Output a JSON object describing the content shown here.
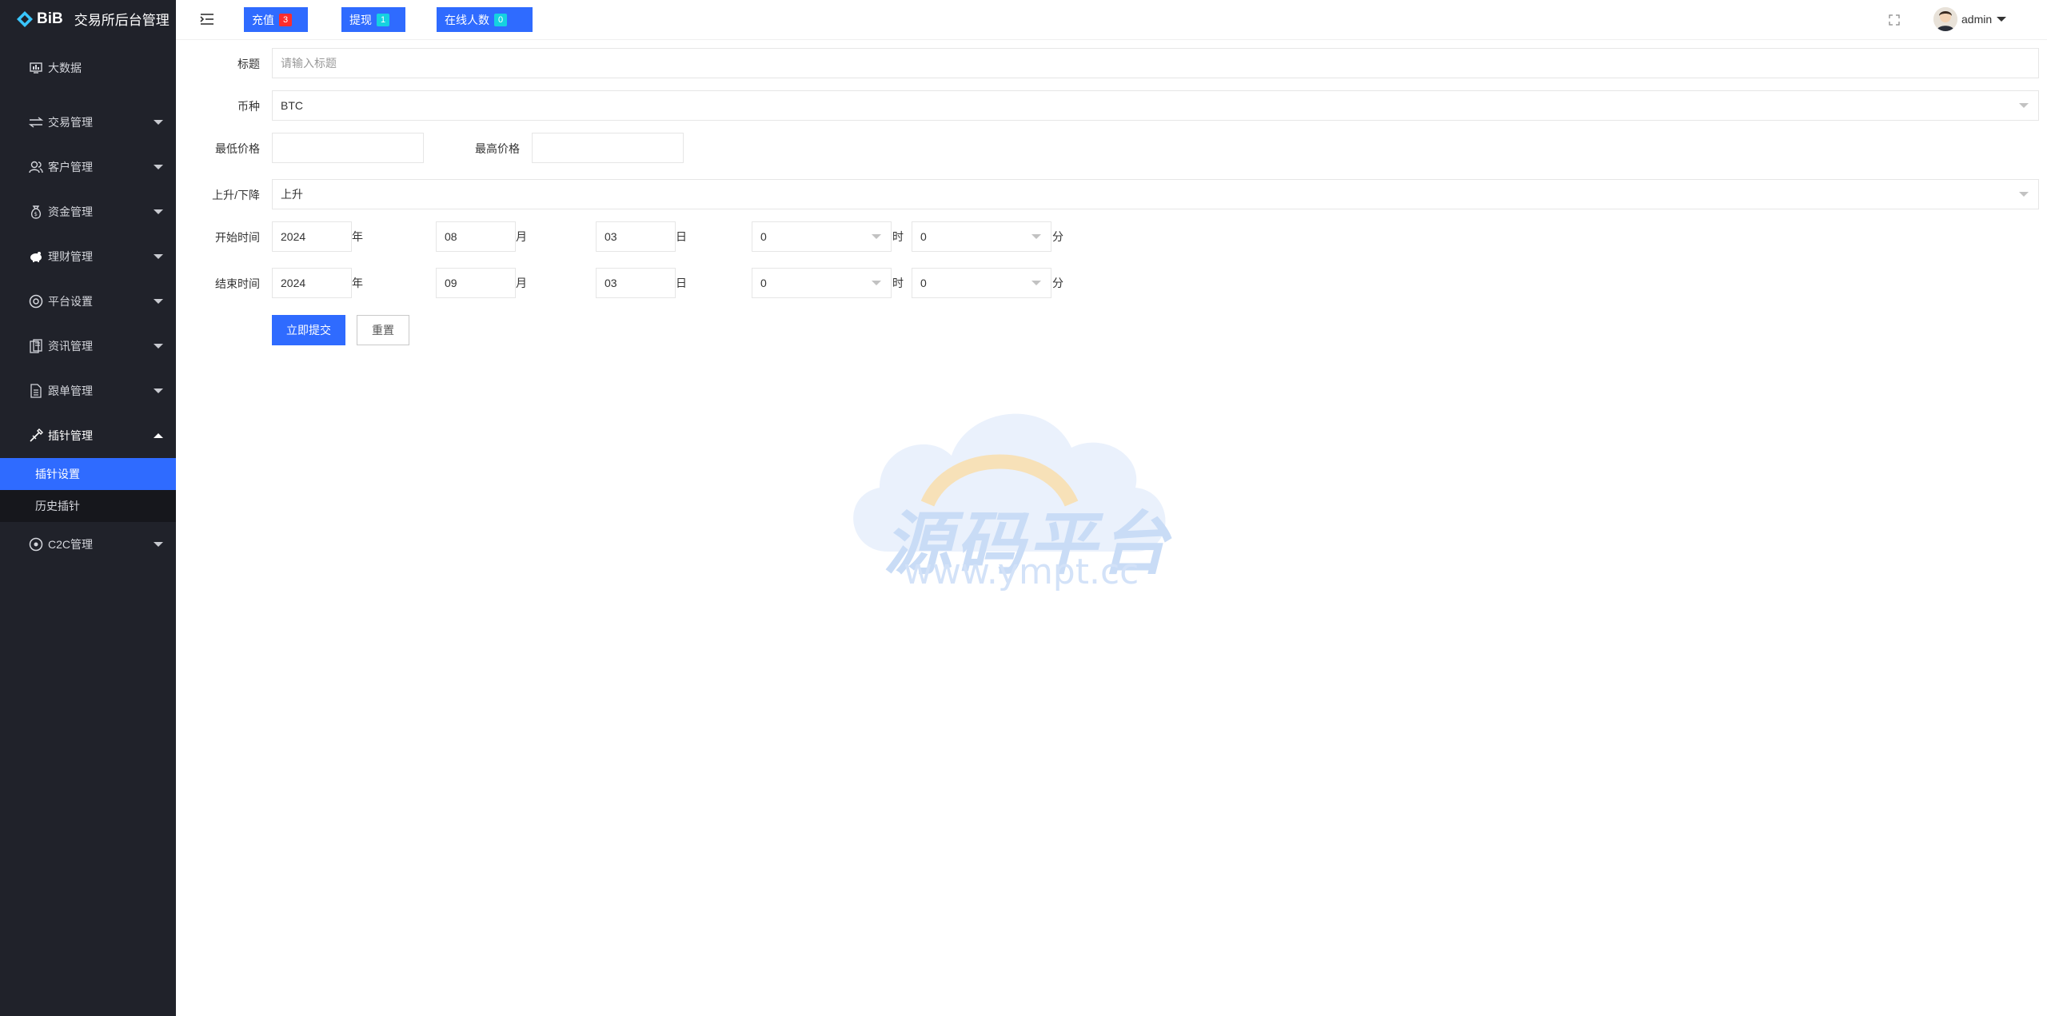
{
  "app": {
    "brand": "BiB",
    "title": "交易所后台管理"
  },
  "sidebar": {
    "items": [
      {
        "label": "大数据",
        "icon": "dashboard-icon",
        "has_caret": false
      },
      {
        "label": "交易管理",
        "icon": "exchange-icon",
        "has_caret": true
      },
      {
        "label": "客户管理",
        "icon": "users-icon",
        "has_caret": true
      },
      {
        "label": "资金管理",
        "icon": "money-bag-icon",
        "has_caret": true
      },
      {
        "label": "理财管理",
        "icon": "piggy-bank-icon",
        "has_caret": true
      },
      {
        "label": "平台设置",
        "icon": "settings-icon",
        "has_caret": true
      },
      {
        "label": "资讯管理",
        "icon": "news-icon",
        "has_caret": true
      },
      {
        "label": "跟单管理",
        "icon": "document-icon",
        "has_caret": true
      },
      {
        "label": "插针管理",
        "icon": "needle-icon",
        "has_caret": true,
        "open": true
      },
      {
        "label": "C2C管理",
        "icon": "c2c-icon",
        "has_caret": true
      }
    ],
    "subitems": [
      {
        "label": "插针设置",
        "active": true
      },
      {
        "label": "历史插针",
        "active": false
      }
    ]
  },
  "header": {
    "recharge_label": "充值",
    "recharge_count": "3",
    "withdraw_label": "提现",
    "withdraw_count": "1",
    "online_label": "在线人数",
    "online_count": "0",
    "username": "admin"
  },
  "form": {
    "title_label": "标题",
    "title_placeholder": "请输入标题",
    "coin_label": "币种",
    "coin_value": "BTC",
    "min_price_label": "最低价格",
    "max_price_label": "最高价格",
    "direction_label": "上升/下降",
    "direction_value": "上升",
    "start_label": "开始时间",
    "start_year": "2024",
    "start_month": "08",
    "start_day": "03",
    "start_hour": "0",
    "start_minute": "0",
    "end_label": "结束时间",
    "end_year": "2024",
    "end_month": "09",
    "end_day": "03",
    "end_hour": "0",
    "end_minute": "0",
    "unit_year": "年",
    "unit_month": "月",
    "unit_day": "日",
    "unit_hour": "时",
    "unit_minute": "分",
    "submit_label": "立即提交",
    "reset_label": "重置"
  },
  "watermark": {
    "title": "源码平台",
    "url": "www.ympt.cc"
  },
  "colors": {
    "sidebar_bg": "#20222a",
    "accent": "#2f6bff",
    "badge_red": "#ff2d2d",
    "badge_cyan": "#15d2e0"
  }
}
